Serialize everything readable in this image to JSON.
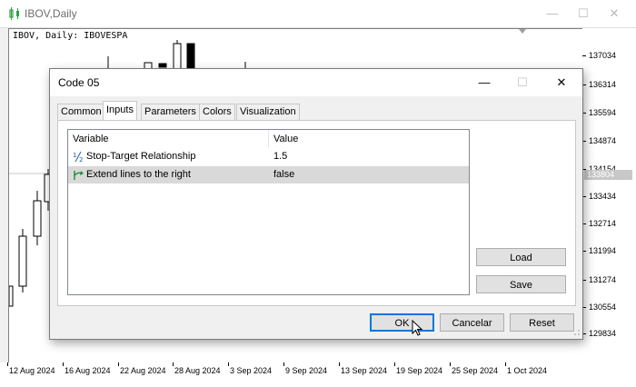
{
  "window": {
    "title": "IBOV,Daily",
    "minimize_icon": "minimize-icon",
    "maximize_icon": "maximize-icon",
    "close_icon": "close-icon"
  },
  "chart": {
    "label": "IBOV, Daily:  IBOVESPA",
    "current_price_badge": "133804",
    "price_axis": [
      "137034",
      "136314",
      "135594",
      "134874",
      "134154",
      "133434",
      "132714",
      "131994",
      "131274",
      "130554",
      "129834"
    ],
    "time_axis": [
      "12 Aug 2024",
      "16 Aug 2024",
      "22 Aug 2024",
      "28 Aug 2024",
      "3 Sep 2024",
      "9 Sep 2024",
      "13 Sep 2024",
      "19 Sep 2024",
      "25 Sep 2024",
      "1 Oct 2024"
    ]
  },
  "dialog": {
    "title": "Code 05",
    "tabs": [
      "Common",
      "Inputs",
      "Parameters",
      "Colors",
      "Visualization"
    ],
    "active_tab": "Inputs",
    "grid": {
      "headers": {
        "variable": "Variable",
        "value": "Value"
      },
      "rows": [
        {
          "variable": "Stop-Target Relationship",
          "value": "1.5",
          "icon": "fraction-icon"
        },
        {
          "variable": "Extend lines to the right",
          "value": "false",
          "icon": "boolean-arrow-icon"
        }
      ]
    },
    "buttons": {
      "load": "Load",
      "save": "Save",
      "ok": "OK",
      "cancel": "Cancelar",
      "reset": "Reset"
    }
  }
}
